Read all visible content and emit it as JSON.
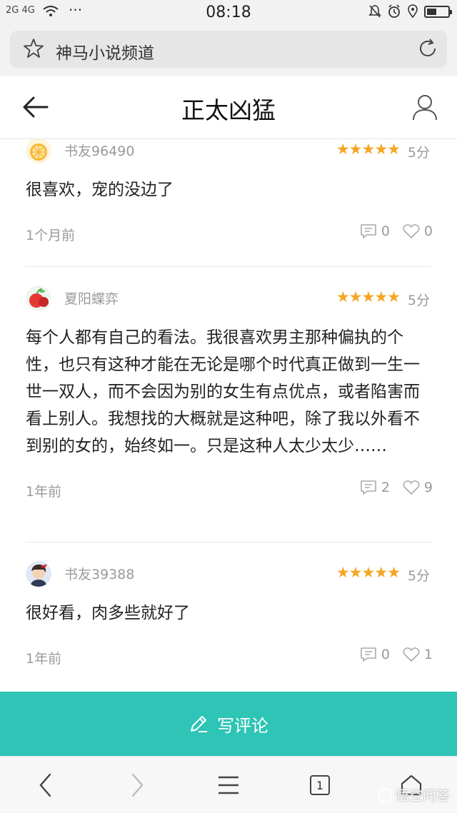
{
  "status_bar": {
    "signal_text": "2G 4G",
    "time": "08:18",
    "battery_level": 0.45,
    "icons": [
      "signal-icon",
      "wifi-icon",
      "more-dots-icon",
      "mute-icon",
      "alarm-icon",
      "location-icon",
      "battery-icon"
    ]
  },
  "browser": {
    "address_text": "神马小说频道"
  },
  "header": {
    "title": "正太凶猛"
  },
  "comments": [
    {
      "username": "书友96490",
      "stars": "★★★★★",
      "score": "5分",
      "text": "很喜欢，宠的没边了",
      "time": "1个月前",
      "reply_count": "0",
      "like_count": "0"
    },
    {
      "username": "夏阳蝶弈",
      "stars": "★★★★★",
      "score": "5分",
      "text": "每个人都有自己的看法。我很喜欢男主那种偏执的个性，也只有这种才能在无论是哪个时代真正做到一生一世一双人，而不会因为别的女生有点优点，或者陷害而看上别人。我想找的大概就是这种吧，除了我以外看不到别的女的，始终如一。只是这种人太少太少……",
      "time": "1年前",
      "reply_count": "2",
      "like_count": "9"
    },
    {
      "username": "书友39388",
      "stars": "★★★★★",
      "score": "5分",
      "text": "很好看，肉多些就好了",
      "time": "1年前",
      "reply_count": "0",
      "like_count": "1"
    }
  ],
  "write_button": {
    "label": "写评论"
  },
  "bottom_nav": {
    "tab_count": "1"
  },
  "watermark": {
    "text": "悟空问答"
  },
  "colors": {
    "accent": "#2ec4b6",
    "star": "#f5a623",
    "muted_text": "#9a9a9a"
  }
}
